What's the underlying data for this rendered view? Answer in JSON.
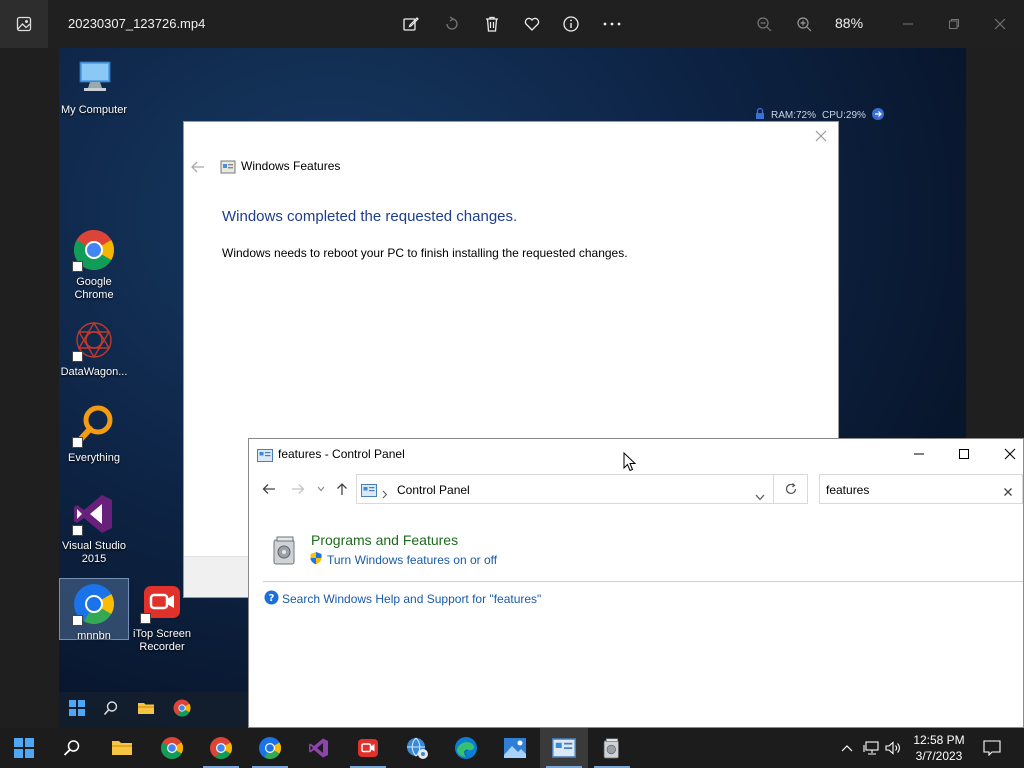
{
  "viewer": {
    "filename": "20230307_123726.mp4",
    "zoom": "88%",
    "tools": [
      "edit-icon",
      "rotate-icon",
      "delete-icon",
      "favorite-icon",
      "info-icon",
      "more-icon"
    ]
  },
  "desktop": {
    "icons": [
      {
        "name": "My Computer",
        "icon": "computer-icon"
      },
      {
        "name": "Google Chrome",
        "icon": "chrome-icon"
      },
      {
        "name": "DataWagon...",
        "icon": "datawagon-icon"
      },
      {
        "name": "Everything",
        "icon": "everything-icon"
      },
      {
        "name": "Visual Studio 2015",
        "icon": "visual-studio-icon"
      },
      {
        "name": "mnnbn",
        "icon": "chrome-icon"
      },
      {
        "name": "iTop Screen Recorder",
        "icon": "itop-recorder-icon"
      }
    ],
    "hud": {
      "ram": "RAM:72%",
      "cpu": "CPU:29%"
    }
  },
  "features_dialog": {
    "title": "Windows Features",
    "heading": "Windows completed the requested changes.",
    "body": "Windows needs to reboot your PC to finish installing the requested changes."
  },
  "control_panel": {
    "title": "features - Control Panel",
    "breadcrumb": "Control Panel",
    "search_value": "features",
    "result_title": "Programs and Features",
    "result_link": "Turn Windows features on or off",
    "help_link": "Search Windows Help and Support for \"features\""
  },
  "taskbar": {
    "time": "12:58 PM",
    "date": "3/7/2023"
  },
  "colors": {
    "accent": "#1a5aa8",
    "heading_blue": "#1e3d8f",
    "category_green": "#1e6a1e"
  }
}
